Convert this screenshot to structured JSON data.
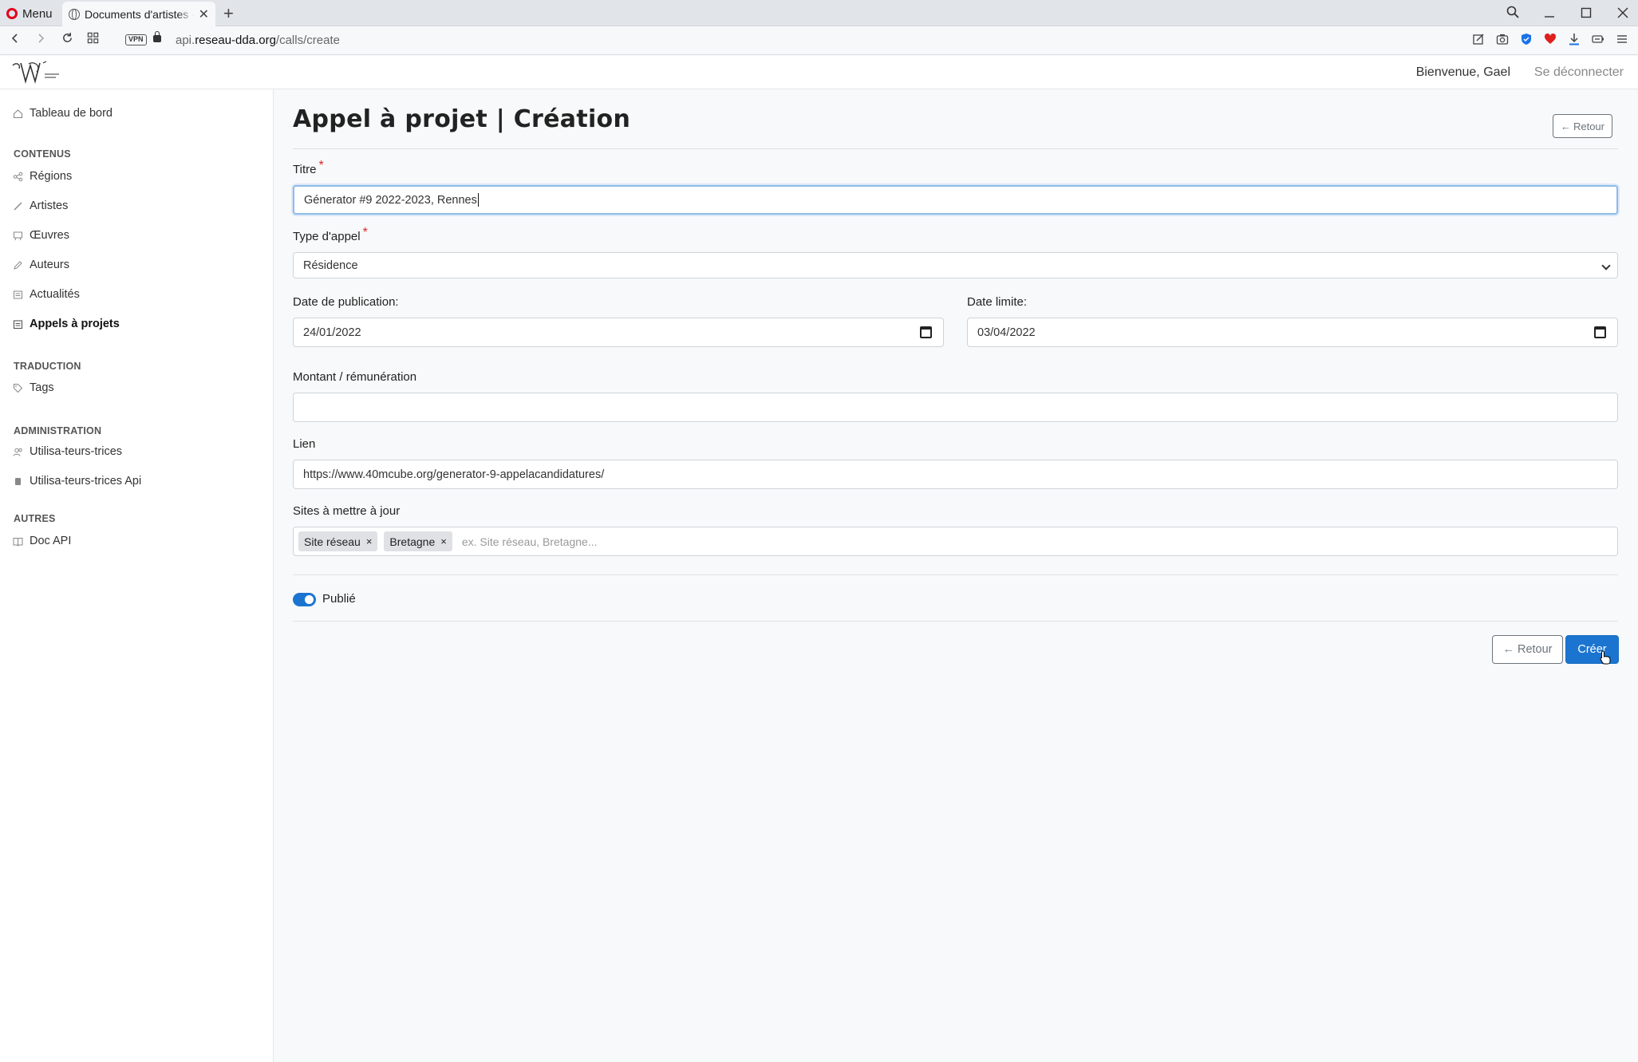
{
  "browser": {
    "menu_label": "Menu",
    "tab_title": "Documents d'artistes - A",
    "url_prefix": "api.",
    "url_domain": "reseau-dda.org",
    "url_path": "/calls/create",
    "vpn_label": "VPN"
  },
  "header": {
    "welcome": "Bienvenue, Gael",
    "logout": "Se déconnecter"
  },
  "sidebar": {
    "dashboard": "Tableau de bord",
    "sections": [
      {
        "title": "CONTENUS",
        "items": [
          "Régions",
          "Artistes",
          "Œuvres",
          "Auteurs",
          "Actualités",
          "Appels à projets"
        ]
      },
      {
        "title": "TRADUCTION",
        "items": [
          "Tags"
        ]
      },
      {
        "title": "ADMINISTRATION",
        "items": [
          "Utilisa-teurs-trices",
          "Utilisa-teurs-trices Api"
        ]
      },
      {
        "title": "AUTRES",
        "items": [
          "Doc API"
        ]
      }
    ],
    "active_item": "Appels à projets"
  },
  "page": {
    "title": "Appel à projet | Création",
    "back_top": "Retour"
  },
  "form": {
    "title_label": "Titre",
    "title_value": "Génerator #9 2022-2023, Rennes",
    "type_label": "Type d'appel",
    "type_value": "Résidence",
    "pub_date_label": "Date de publication:",
    "pub_date_value": "24/01/2022",
    "deadline_label": "Date limite:",
    "deadline_value": "03/04/2022",
    "amount_label": "Montant / rémunération",
    "amount_value": "",
    "link_label": "Lien",
    "link_value": "https://www.40mcube.org/generator-9-appelacandidatures/",
    "sites_label": "Sites à mettre à jour",
    "sites_tags": [
      "Site réseau",
      "Bretagne"
    ],
    "sites_placeholder": "ex. Site réseau, Bretagne...",
    "published_label": "Publié",
    "published": true,
    "back_label": "Retour",
    "create_label": "Créer"
  },
  "colors": {
    "primary": "#1b75d0",
    "required": "#e02424",
    "secondary": "#6c757d"
  }
}
